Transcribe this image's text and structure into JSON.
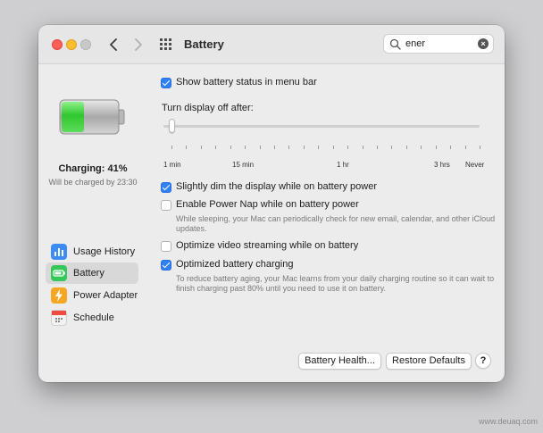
{
  "window": {
    "title": "Battery"
  },
  "search": {
    "query": "ener"
  },
  "sidebar": {
    "charge_status": "Charging: 41%",
    "charge_detail": "Will be charged by 23:30",
    "charge_percent": 41,
    "items": [
      {
        "label": "Usage History",
        "icon": "bar-chart-icon",
        "color": "#3b8cf5"
      },
      {
        "label": "Battery",
        "icon": "battery-icon",
        "color": "#34c759",
        "selected": true
      },
      {
        "label": "Power Adapter",
        "icon": "lightning-bolt-icon",
        "color": "#f5a623"
      },
      {
        "label": "Schedule",
        "icon": "calendar-icon",
        "color": "#d9d9d9"
      }
    ]
  },
  "options": {
    "show_status": {
      "label": "Show battery status in menu bar",
      "checked": true
    },
    "display_off_label": "Turn display off after:",
    "slider": {
      "value": "1 min",
      "tick_labels": [
        "1 min",
        "15 min",
        "1 hr",
        "3 hrs",
        "Never"
      ]
    },
    "dim_display": {
      "label": "Slightly dim the display while on battery power",
      "checked": true
    },
    "power_nap": {
      "label": "Enable Power Nap while on battery power",
      "checked": false,
      "description": "While sleeping, your Mac can periodically check for new email, calendar, and other iCloud updates."
    },
    "video_streaming": {
      "label": "Optimize video streaming while on battery",
      "checked": false
    },
    "optimized_charging": {
      "label": "Optimized battery charging",
      "checked": true,
      "description": "To reduce battery aging, your Mac learns from your daily charging routine so it can wait to finish charging past 80% until you need to use it on battery."
    }
  },
  "buttons": {
    "battery_health": "Battery Health...",
    "restore_defaults": "Restore Defaults",
    "help": "?"
  },
  "watermark": "www.deuaq.com",
  "colors": {
    "accent": "#2f7ff5",
    "battery_green": "#3fcf3f"
  }
}
